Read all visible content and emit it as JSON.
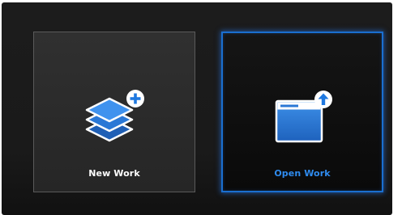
{
  "cards": {
    "new_work": {
      "label": "New Work",
      "icon": "layers-plus-icon"
    },
    "open_work": {
      "label": "Open Work",
      "icon": "window-upload-icon",
      "selected": true
    }
  },
  "colors": {
    "background": "#1a1a1a",
    "card_background": "#2b2b2b",
    "accent": "#1e78e0",
    "label_default": "#ffffff",
    "label_selected": "#2f8cf0"
  }
}
